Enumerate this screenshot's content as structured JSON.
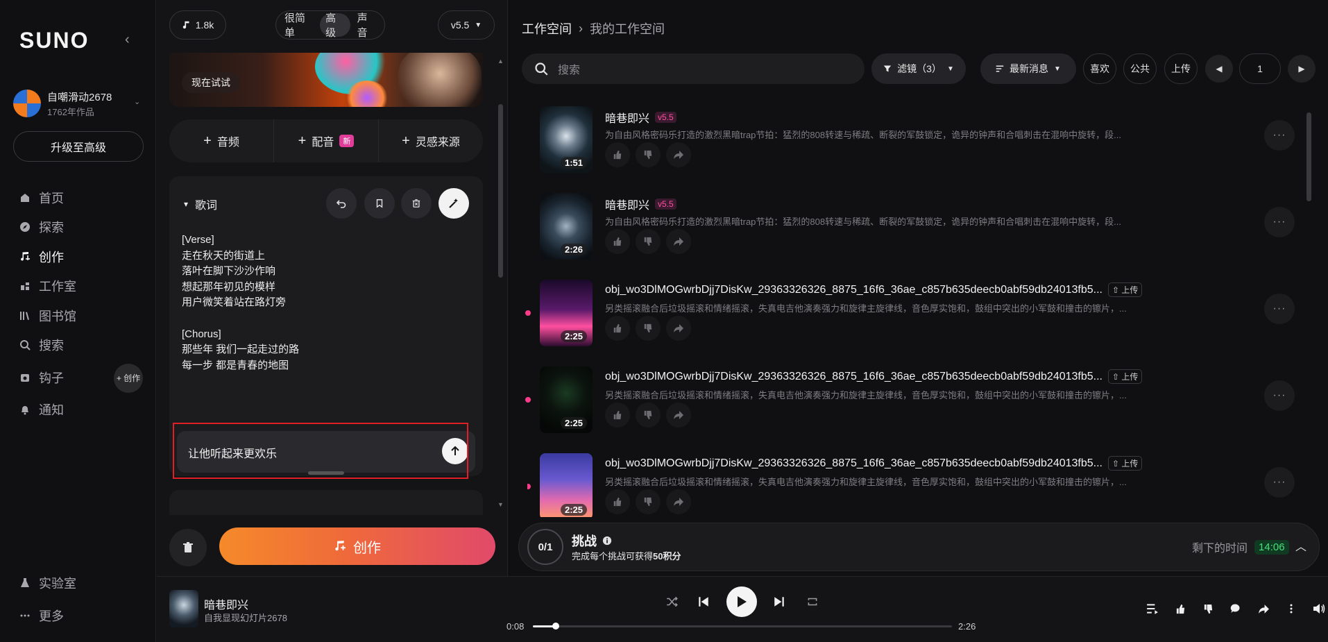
{
  "sidebar": {
    "logo": "SUNO",
    "user": {
      "name": "自嘲滑动2678",
      "works": "1762年作品"
    },
    "upgrade_label": "升级至高级",
    "nav": [
      {
        "label": "首页",
        "icon": "home-icon"
      },
      {
        "label": "探索",
        "icon": "compass-icon"
      },
      {
        "label": "创作",
        "icon": "music-note-icon",
        "active": true
      },
      {
        "label": "工作室",
        "icon": "studio-icon"
      },
      {
        "label": "图书馆",
        "icon": "library-icon"
      },
      {
        "label": "搜索",
        "icon": "search-icon"
      },
      {
        "label": "钩子",
        "icon": "hook-icon"
      },
      {
        "label": "通知",
        "icon": "bell-icon"
      }
    ],
    "hook_create_label": "+ 创作",
    "bottom_nav": [
      {
        "label": "实验室",
        "icon": "flask-icon"
      },
      {
        "label": "更多",
        "icon": "more-icon"
      }
    ]
  },
  "create": {
    "credits": "1.8k",
    "modes": [
      "很简单",
      "高级",
      "声音"
    ],
    "active_mode": "高级",
    "version": "v5.5",
    "try_now_label": "现在试试",
    "add_buttons": [
      {
        "label": "音频"
      },
      {
        "label": "配音",
        "badge": "新"
      },
      {
        "label": "灵感来源"
      }
    ],
    "lyrics": {
      "title": "歌词",
      "text": "[Verse]\n走在秋天的街道上\n落叶在脚下沙沙作响\n想起那年初见的模样\n用户微笑着站在路灯旁\n\n[Chorus]\n那些年 我们一起走过的路\n每一步 都是青春的地图"
    },
    "prompt_value": "让他听起来更欢乐",
    "create_label": "创作"
  },
  "workspace": {
    "breadcrumb": [
      "工作空间",
      "我的工作空间"
    ],
    "search_placeholder": "搜索",
    "filter_label": "滤镜（3）",
    "sort_label": "最新消息",
    "quick_filters": [
      "喜欢",
      "公共",
      "上传"
    ],
    "page": "1",
    "songs": [
      {
        "title": "暗巷即兴",
        "version": "v5.5",
        "duration": "1:51",
        "desc": "为自由风格密码乐打造的激烈黑暗trap节拍：猛烈的808转速与稀疏、断裂的军鼓锁定，诡异的钟声和合唱刺击在混响中旋转，段...",
        "new": false,
        "uploaded": false
      },
      {
        "title": "暗巷即兴",
        "version": "v5.5",
        "duration": "2:26",
        "desc": "为自由风格密码乐打造的激烈黑暗trap节拍：猛烈的808转速与稀疏、断裂的军鼓锁定，诡异的钟声和合唱刺击在混响中旋转，段...",
        "new": false,
        "uploaded": false
      },
      {
        "title": "obj_wo3DlMOGwrbDjj7DisKw_29363326326_8875_16f6_36ae_c857b635deecb0abf59db24013fb5...",
        "upload_label": "上传",
        "duration": "2:25",
        "desc": "另类摇滚融合后垃圾摇滚和情绪摇滚，失真电吉他演奏强力和旋律主旋律线，音色厚实饱和，鼓组中突出的小军鼓和撞击的镲片，...",
        "new": true,
        "uploaded": true
      },
      {
        "title": "obj_wo3DlMOGwrbDjj7DisKw_29363326326_8875_16f6_36ae_c857b635deecb0abf59db24013fb5...",
        "upload_label": "上传",
        "duration": "2:25",
        "desc": "另类摇滚融合后垃圾摇滚和情绪摇滚，失真电吉他演奏强力和旋律主旋律线，音色厚实饱和，鼓组中突出的小军鼓和撞击的镲片，...",
        "new": true,
        "uploaded": true
      },
      {
        "title": "obj_wo3DlMOGwrbDjj7DisKw_29363326326_8875_16f6_36ae_c857b635deecb0abf59db24013fb5...",
        "upload_label": "上传",
        "duration": "2:25",
        "desc": "另类摇滚融合后垃圾摇滚和情绪摇滚，失真电吉他演奏强力和旋律主旋律线，音色厚实饱和，鼓组中突出的小军鼓和撞击的镲片，...",
        "new": true,
        "uploaded": true
      }
    ],
    "challenge": {
      "count": "0/1",
      "title": "挑战",
      "sub_prefix": "完成每个挑战可获得",
      "sub_points": "50积分",
      "remain_label": "剩下的时间",
      "timer": "14:06"
    }
  },
  "player": {
    "title": "暗巷即兴",
    "artist": "自我显现幻灯片2678",
    "elapsed": "0:08",
    "total": "2:26",
    "progress": 0.055
  }
}
